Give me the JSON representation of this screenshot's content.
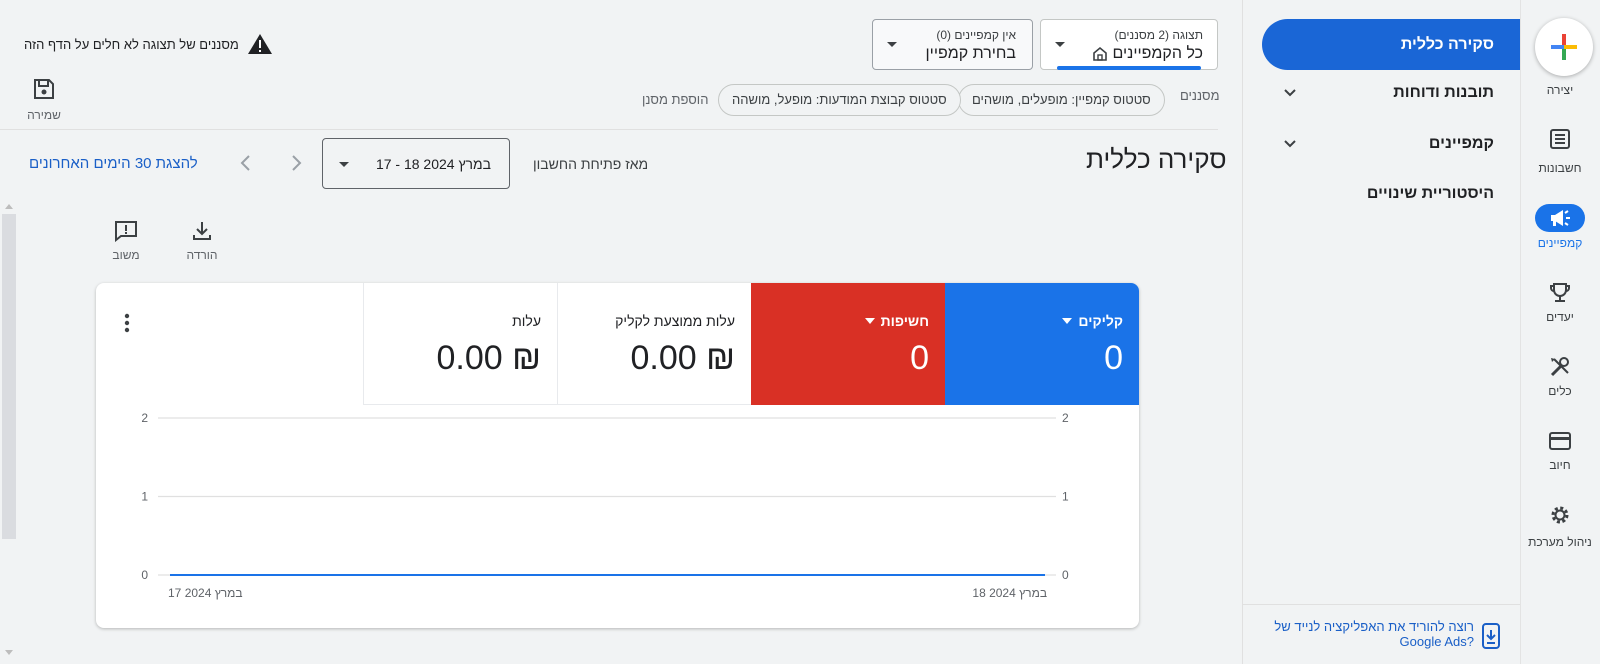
{
  "rail": {
    "create_label": "יצירה",
    "items": [
      {
        "label": "חשבונות",
        "icon": "accounts-icon",
        "active": false
      },
      {
        "label": "קמפיינים",
        "icon": "megaphone-icon",
        "active": true
      },
      {
        "label": "יעדים",
        "icon": "trophy-icon",
        "active": false
      },
      {
        "label": "כלים",
        "icon": "tools-icon",
        "active": false
      },
      {
        "label": "חיוב",
        "icon": "credit-card-icon",
        "active": false
      },
      {
        "label": "ניהול מערכת",
        "icon": "gear-icon",
        "active": false
      }
    ]
  },
  "sidemenu": {
    "active": "סקירה כללית",
    "items": [
      "תובנות ודוחות",
      "קמפיינים",
      "היסטוריית שינויים"
    ],
    "app_promo": "רוצה להוריד את האפליקציה לנייד של Google Ads?"
  },
  "header": {
    "view_sub": "תצוגה (2 מסננים)",
    "view_main": "כל הקמפיינים",
    "campaign_sub": "אין קמפיינים (0)",
    "campaign_main": "בחירת קמפיין",
    "warning": "מסננים של תצוגה לא חלים על הדף הזה",
    "save_label": "שמירה",
    "filters_label": "מסננים",
    "chips": [
      "סטטוס קמפיין: מופעלים, מושהים",
      "סטטוס קבוצת המודעות: מופעל, מושהה"
    ],
    "add_filter": "הוספת מסנן"
  },
  "title_row": {
    "title": "סקירה כללית",
    "date_label": "מאז פתיחת החשבון",
    "date_value": "17 - 18 במרץ 2024",
    "last30": "להצגת 30 הימים האחרונים"
  },
  "toolbar": {
    "download": "הורדה",
    "feedback": "משוב"
  },
  "metrics": {
    "clicks": {
      "label": "קליקים",
      "value": "0"
    },
    "impressions": {
      "label": "חשיפות",
      "value": "0"
    },
    "avg_cpc": {
      "label": "עלות ממוצעת לקליק",
      "value": "0.00 ₪"
    },
    "cost": {
      "label": "עלות",
      "value": "0.00 ₪"
    }
  },
  "colors": {
    "clicks": "#1a73e8",
    "impressions": "#d93025",
    "accent": "#1a66d6"
  },
  "chart_data": {
    "type": "line",
    "x": [
      "17 במרץ 2024",
      "18 במרץ 2024"
    ],
    "series": [
      {
        "name": "קליקים",
        "values": [
          0,
          0
        ],
        "color": "#1a73e8"
      },
      {
        "name": "חשיפות",
        "values": [
          0,
          0
        ],
        "color": "#d93025"
      }
    ],
    "y_ticks": [
      0,
      1,
      2
    ],
    "ylim": [
      0,
      2
    ],
    "grid": true
  }
}
